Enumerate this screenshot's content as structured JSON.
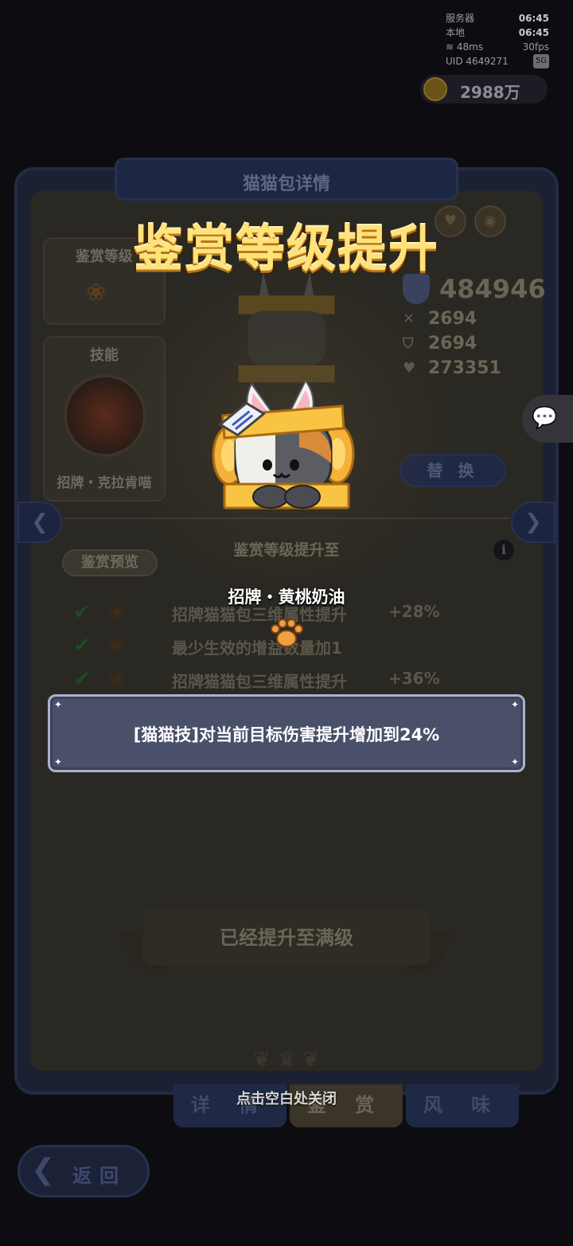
{
  "status": {
    "server_label": "服务器",
    "server_time": "06:45",
    "local_label": "本地",
    "local_time": "06:45",
    "ping": "48ms",
    "fps": "30fps",
    "uid": "UID 4649271"
  },
  "currency": {
    "amount": "2988万"
  },
  "panel": {
    "title": "猫猫包详情",
    "appraisal_level_label": "鉴赏等级",
    "skill_label": "技能",
    "skill_name": "招牌・克拉肯喵",
    "power": "484946",
    "attack": "2694",
    "defense": "2694",
    "hp": "273351",
    "replace_label": "替 换",
    "preview_label": "鉴赏预览",
    "upgrade_to_label": "鉴赏等级提升至",
    "bonuses": [
      {
        "text": "招牌猫猫包三维属性提升",
        "value": "+28%"
      },
      {
        "text": "最少生效的增益数量加1",
        "value": ""
      },
      {
        "text": "招牌猫猫包三维属性提升",
        "value": "+36%"
      }
    ],
    "maxed_label": "已经提升至满级",
    "tabs": [
      "详 情",
      "鉴 赏",
      "风 味"
    ],
    "back_label": "返回"
  },
  "popup": {
    "title": "鉴赏等级提升",
    "cat_name": "招牌・黄桃奶油",
    "description": "[猫猫技]对当前目标伤害提升增加到24%",
    "close_hint": "点击空白处关闭"
  },
  "colors": {
    "title_gold": "#ffe27a",
    "dialog_bg": "#4a5069",
    "dialog_border": "#a8b2cf",
    "paw_orange": "#f0a040",
    "cat_gold": "#f4b23a"
  },
  "icons": [
    "coin-icon",
    "heart-icon",
    "lock-icon",
    "shield-icon",
    "sword-icon",
    "armor-icon",
    "hp-heart-icon",
    "chat-icon",
    "arrow-left-icon",
    "arrow-right-icon",
    "info-icon",
    "check-icon",
    "paw-icon",
    "back-arrow-icon"
  ]
}
